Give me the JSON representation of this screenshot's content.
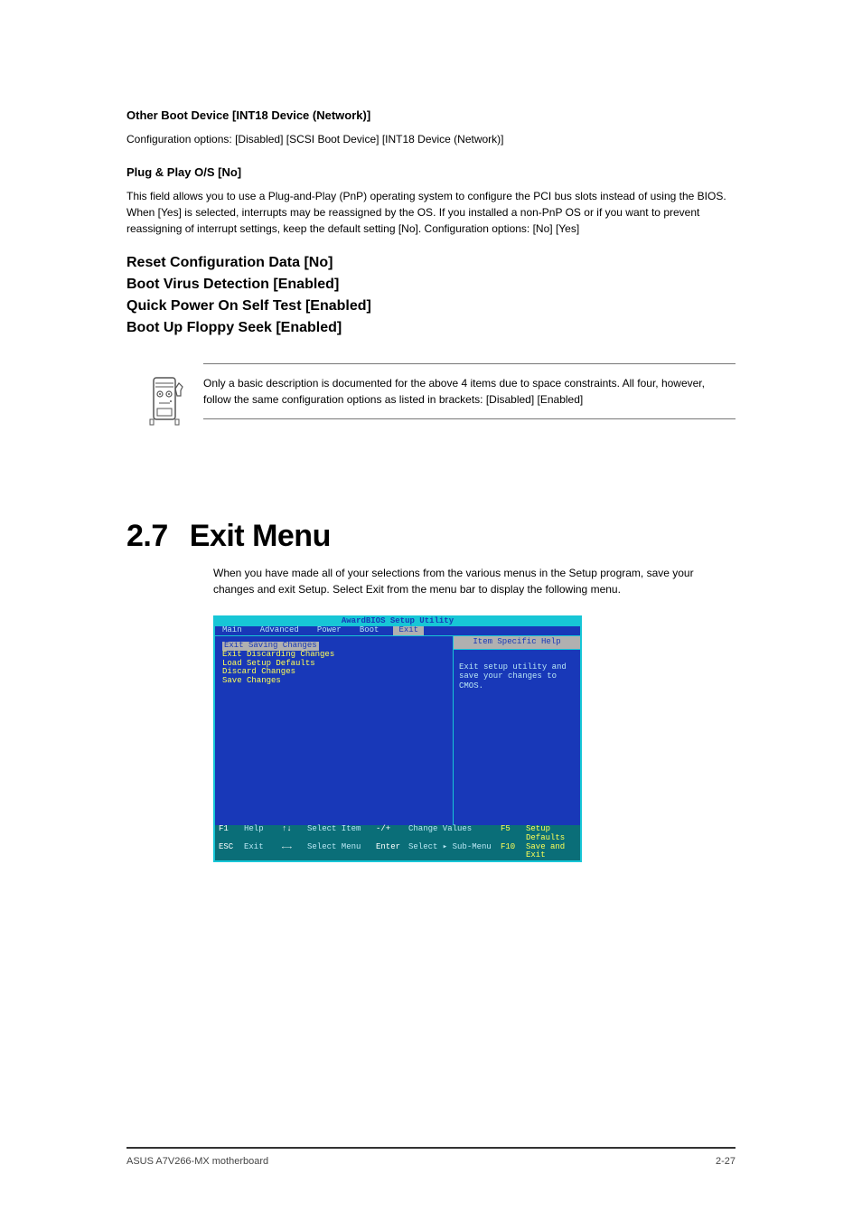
{
  "config": {
    "heading": "Other Boot Device [INT18 Device (Network)]",
    "desc_pre": "Configuration options: [Disabled] [SCSI Boot Device] [INT18 Device (Network)]"
  },
  "drive": {
    "heading": "Plug & Play O/S [No]",
    "desc": "This field allows you to use a Plug-and-Play (PnP) operating system to configure the PCI bus slots instead of using the BIOS. When [Yes] is selected, interrupts may be reassigned by the OS. If you installed a non-PnP OS or if you want to prevent reassigning of interrupt settings, keep the default setting [No]. Configuration options: [No] [Yes]"
  },
  "items": [
    {
      "label": "Reset Configuration Data [No]",
      "desc": ""
    },
    {
      "label": "Boot Virus Detection [Enabled]",
      "desc": ""
    },
    {
      "label": "Quick Power On Self Test [Enabled]",
      "desc": ""
    },
    {
      "label": "Boot Up Floppy Seek [Enabled]",
      "desc": ""
    }
  ],
  "callout": {
    "text": "Only a basic description is documented for the above 4 items due to space constraints. All four, however, follow the same configuration options as listed in brackets: [Disabled] [Enabled]"
  },
  "section": {
    "number": "2.7",
    "title": "Exit Menu",
    "after": "When you have made all of your selections from the various menus in the Setup program, save your changes and exit Setup. Select Exit from the menu bar to display the following menu."
  },
  "bios": {
    "utility_title": "AwardBIOS Setup Utility",
    "menus": [
      "Main",
      "Advanced",
      "Power",
      "Boot",
      "Exit"
    ],
    "active_menu": 4,
    "left": {
      "selected": "Exit Saving Changes",
      "rows": [
        "Exit Discarding Changes",
        "Load Setup Defaults",
        "Discard Changes",
        "Save Changes"
      ]
    },
    "right": {
      "head": "Item Specific Help",
      "body": "Exit setup utility and save your changes to CMOS."
    },
    "footer": {
      "r1": {
        "k1": "F1",
        "v1": "Help",
        "k2": "↑↓",
        "v2": "Select Item",
        "k3": "-/+",
        "v3": "Change Values",
        "k4": "F5",
        "v4": "Setup Defaults"
      },
      "r2": {
        "k1": "ESC",
        "v1": "Exit",
        "k2": "←→",
        "v2": "Select Menu",
        "k3": "Enter",
        "v3": "Select ▸ Sub-Menu",
        "k4": "F10",
        "v4": "Save and Exit"
      }
    }
  },
  "footer": {
    "left": "ASUS A7V266-MX motherboard",
    "right": "2-27"
  }
}
